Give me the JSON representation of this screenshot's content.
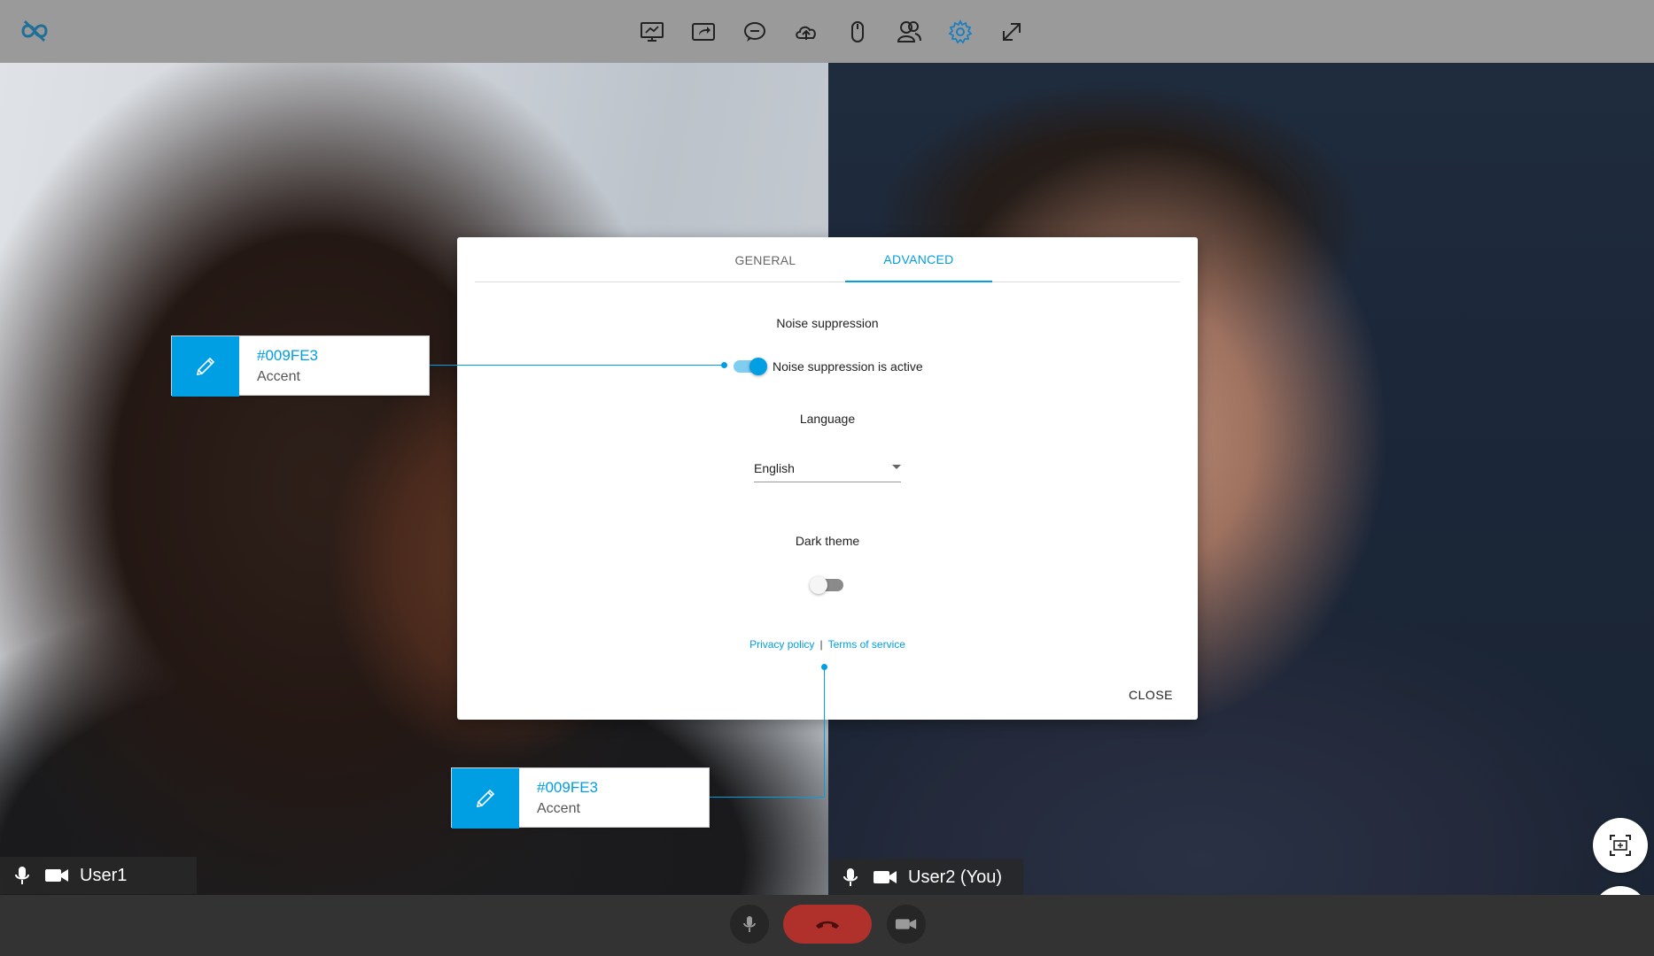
{
  "colors": {
    "accent": "#009FE3",
    "toolbar_bg": "#9a9a9a",
    "bottombar_bg": "#333333",
    "hangup": "#b0312b"
  },
  "toolbar": {
    "logo_icon": "infinity-link-icon",
    "tools": [
      {
        "name": "presentation-icon"
      },
      {
        "name": "share-icon"
      },
      {
        "name": "chat-icon"
      },
      {
        "name": "cloud-upload-icon"
      },
      {
        "name": "mouse-icon"
      },
      {
        "name": "participants-icon"
      },
      {
        "name": "settings-icon",
        "active": true
      },
      {
        "name": "expand-icon"
      }
    ]
  },
  "participants": [
    {
      "name": "User1"
    },
    {
      "name": "User2 (You)"
    }
  ],
  "settings_dialog": {
    "tabs": [
      {
        "label": "GENERAL",
        "active": false
      },
      {
        "label": "ADVANCED",
        "active": true
      }
    ],
    "noise_suppression": {
      "heading": "Noise suppression",
      "toggle_label": "Noise suppression is active",
      "enabled": true
    },
    "language": {
      "heading": "Language",
      "selected": "English"
    },
    "dark_theme": {
      "heading": "Dark theme",
      "enabled": false
    },
    "links": {
      "privacy": "Privacy policy",
      "separator": "|",
      "terms": "Terms of service"
    },
    "close_label": "CLOSE"
  },
  "annotations": [
    {
      "hex": "#009FE3",
      "role": "Accent"
    },
    {
      "hex": "#009FE3",
      "role": "Accent"
    }
  ]
}
